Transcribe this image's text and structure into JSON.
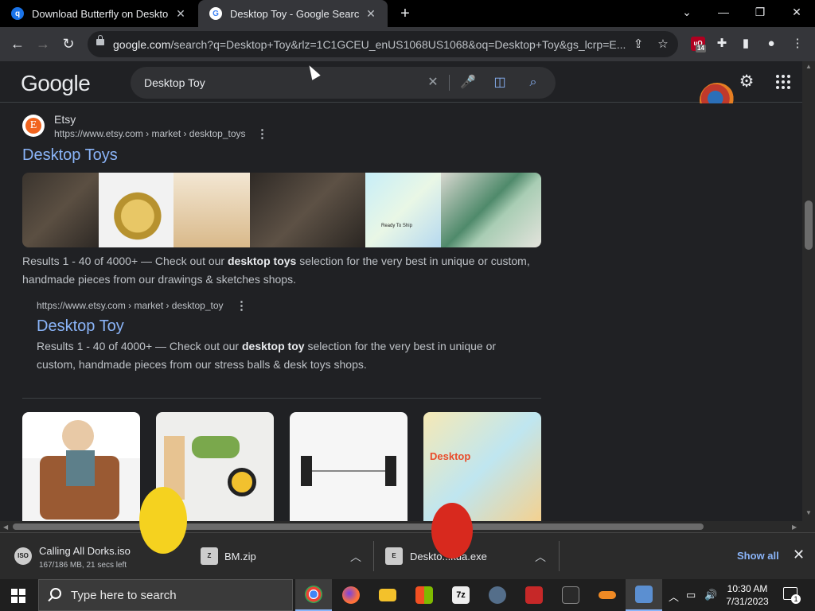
{
  "browser": {
    "tabs": [
      {
        "title": "Download Butterfly on Desktop",
        "icon": "q"
      },
      {
        "title": "Desktop Toy - Google Search",
        "icon": "G"
      }
    ],
    "new_tab": "+",
    "url_domain": "google.com",
    "url_rest": "/search?q=Desktop+Toy&rlz=1C1GCEU_enUS1068US1068&oq=Desktop+Toy&gs_lcrp=E...",
    "extension_badge": "14"
  },
  "google": {
    "logo": "Google",
    "query": "Desktop Toy"
  },
  "results": [
    {
      "site_name": "Etsy",
      "site_letter": "E",
      "breadcrumb": "https://www.etsy.com › market › desktop_toys",
      "title": "Desktop Toys",
      "snippet_pre": "Results 1 - 40 of 4000+ — Check out our ",
      "snippet_bold": "desktop toys",
      "snippet_post": " selection for the very best in unique or custom, handmade pieces from our drawings & sketches shops.",
      "thumb_caption": "Ready To Ship"
    },
    {
      "breadcrumb": "https://www.etsy.com › market › desktop_toy",
      "title": "Desktop Toy",
      "snippet_pre": "Results 1 - 40 of 4000+ — Check out our ",
      "snippet_bold": "desktop toy",
      "snippet_post": " selection for the very best in unique or custom, handmade pieces from our stress balls & desk toys shops."
    }
  ],
  "product_cards": [
    {
      "kind": "figure",
      "label": ""
    },
    {
      "kind": "toys",
      "label": ""
    },
    {
      "kind": "magnet",
      "label": ""
    },
    {
      "kind": "box",
      "label": "Desktop"
    }
  ],
  "downloads": [
    {
      "name": "Calling All Dorks.iso",
      "sub": "167/186 MB, 21 secs left",
      "icon": "ISO"
    },
    {
      "name": "BM.zip",
      "sub": "",
      "icon": "Z"
    },
    {
      "name": "Deskto...kua.exe",
      "sub": "",
      "icon": "E"
    }
  ],
  "downloads_show_all": "Show all",
  "taskbar": {
    "search_placeholder": "Type here to search",
    "time": "10:30 AM",
    "date": "7/31/2023",
    "notification_count": "1"
  },
  "colors": {
    "link": "#8ab4f8",
    "page_bg": "#202124",
    "etsy_orange": "#f1641e"
  }
}
